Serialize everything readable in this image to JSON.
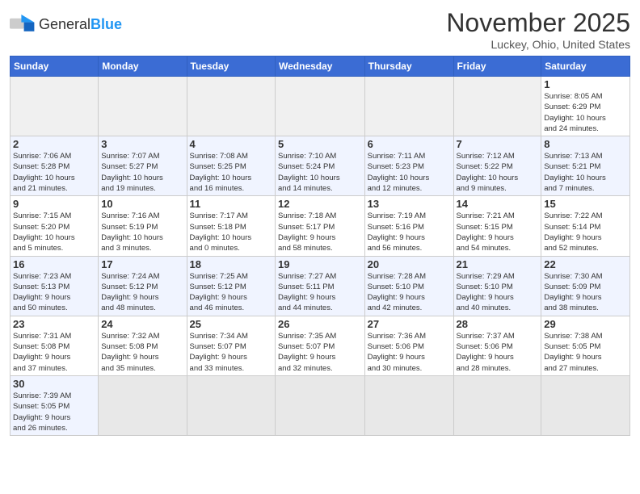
{
  "logo": {
    "text_normal": "General",
    "text_blue": "Blue"
  },
  "title": "November 2025",
  "location": "Luckey, Ohio, United States",
  "days_of_week": [
    "Sunday",
    "Monday",
    "Tuesday",
    "Wednesday",
    "Thursday",
    "Friday",
    "Saturday"
  ],
  "weeks": [
    [
      {
        "day": "",
        "info": ""
      },
      {
        "day": "",
        "info": ""
      },
      {
        "day": "",
        "info": ""
      },
      {
        "day": "",
        "info": ""
      },
      {
        "day": "",
        "info": ""
      },
      {
        "day": "",
        "info": ""
      },
      {
        "day": "1",
        "info": "Sunrise: 8:05 AM\nSunset: 6:29 PM\nDaylight: 10 hours\nand 24 minutes."
      }
    ],
    [
      {
        "day": "2",
        "info": "Sunrise: 7:06 AM\nSunset: 5:28 PM\nDaylight: 10 hours\nand 21 minutes."
      },
      {
        "day": "3",
        "info": "Sunrise: 7:07 AM\nSunset: 5:27 PM\nDaylight: 10 hours\nand 19 minutes."
      },
      {
        "day": "4",
        "info": "Sunrise: 7:08 AM\nSunset: 5:25 PM\nDaylight: 10 hours\nand 16 minutes."
      },
      {
        "day": "5",
        "info": "Sunrise: 7:10 AM\nSunset: 5:24 PM\nDaylight: 10 hours\nand 14 minutes."
      },
      {
        "day": "6",
        "info": "Sunrise: 7:11 AM\nSunset: 5:23 PM\nDaylight: 10 hours\nand 12 minutes."
      },
      {
        "day": "7",
        "info": "Sunrise: 7:12 AM\nSunset: 5:22 PM\nDaylight: 10 hours\nand 9 minutes."
      },
      {
        "day": "8",
        "info": "Sunrise: 7:13 AM\nSunset: 5:21 PM\nDaylight: 10 hours\nand 7 minutes."
      }
    ],
    [
      {
        "day": "9",
        "info": "Sunrise: 7:15 AM\nSunset: 5:20 PM\nDaylight: 10 hours\nand 5 minutes."
      },
      {
        "day": "10",
        "info": "Sunrise: 7:16 AM\nSunset: 5:19 PM\nDaylight: 10 hours\nand 3 minutes."
      },
      {
        "day": "11",
        "info": "Sunrise: 7:17 AM\nSunset: 5:18 PM\nDaylight: 10 hours\nand 0 minutes."
      },
      {
        "day": "12",
        "info": "Sunrise: 7:18 AM\nSunset: 5:17 PM\nDaylight: 9 hours\nand 58 minutes."
      },
      {
        "day": "13",
        "info": "Sunrise: 7:19 AM\nSunset: 5:16 PM\nDaylight: 9 hours\nand 56 minutes."
      },
      {
        "day": "14",
        "info": "Sunrise: 7:21 AM\nSunset: 5:15 PM\nDaylight: 9 hours\nand 54 minutes."
      },
      {
        "day": "15",
        "info": "Sunrise: 7:22 AM\nSunset: 5:14 PM\nDaylight: 9 hours\nand 52 minutes."
      }
    ],
    [
      {
        "day": "16",
        "info": "Sunrise: 7:23 AM\nSunset: 5:13 PM\nDaylight: 9 hours\nand 50 minutes."
      },
      {
        "day": "17",
        "info": "Sunrise: 7:24 AM\nSunset: 5:12 PM\nDaylight: 9 hours\nand 48 minutes."
      },
      {
        "day": "18",
        "info": "Sunrise: 7:25 AM\nSunset: 5:12 PM\nDaylight: 9 hours\nand 46 minutes."
      },
      {
        "day": "19",
        "info": "Sunrise: 7:27 AM\nSunset: 5:11 PM\nDaylight: 9 hours\nand 44 minutes."
      },
      {
        "day": "20",
        "info": "Sunrise: 7:28 AM\nSunset: 5:10 PM\nDaylight: 9 hours\nand 42 minutes."
      },
      {
        "day": "21",
        "info": "Sunrise: 7:29 AM\nSunset: 5:10 PM\nDaylight: 9 hours\nand 40 minutes."
      },
      {
        "day": "22",
        "info": "Sunrise: 7:30 AM\nSunset: 5:09 PM\nDaylight: 9 hours\nand 38 minutes."
      }
    ],
    [
      {
        "day": "23",
        "info": "Sunrise: 7:31 AM\nSunset: 5:08 PM\nDaylight: 9 hours\nand 37 minutes."
      },
      {
        "day": "24",
        "info": "Sunrise: 7:32 AM\nSunset: 5:08 PM\nDaylight: 9 hours\nand 35 minutes."
      },
      {
        "day": "25",
        "info": "Sunrise: 7:34 AM\nSunset: 5:07 PM\nDaylight: 9 hours\nand 33 minutes."
      },
      {
        "day": "26",
        "info": "Sunrise: 7:35 AM\nSunset: 5:07 PM\nDaylight: 9 hours\nand 32 minutes."
      },
      {
        "day": "27",
        "info": "Sunrise: 7:36 AM\nSunset: 5:06 PM\nDaylight: 9 hours\nand 30 minutes."
      },
      {
        "day": "28",
        "info": "Sunrise: 7:37 AM\nSunset: 5:06 PM\nDaylight: 9 hours\nand 28 minutes."
      },
      {
        "day": "29",
        "info": "Sunrise: 7:38 AM\nSunset: 5:05 PM\nDaylight: 9 hours\nand 27 minutes."
      }
    ],
    [
      {
        "day": "30",
        "info": "Sunrise: 7:39 AM\nSunset: 5:05 PM\nDaylight: 9 hours\nand 26 minutes."
      },
      {
        "day": "",
        "info": ""
      },
      {
        "day": "",
        "info": ""
      },
      {
        "day": "",
        "info": ""
      },
      {
        "day": "",
        "info": ""
      },
      {
        "day": "",
        "info": ""
      },
      {
        "day": "",
        "info": ""
      }
    ]
  ]
}
